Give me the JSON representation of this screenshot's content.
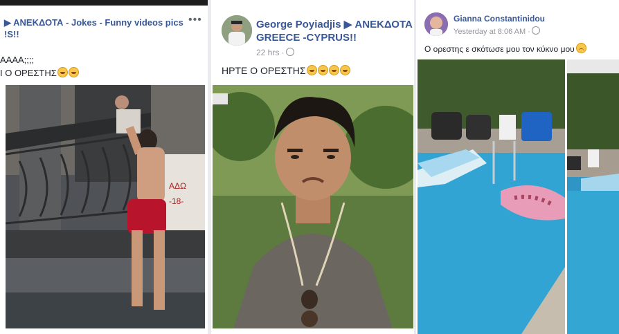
{
  "panel1": {
    "group_title_line1": "▶ ΑΝΕΚΔΟΤΑ - Jokes - Funny videos pics",
    "group_title_line2": "!S!!",
    "more_label": "•••",
    "text_line1": "AAAA;;;;",
    "text_line2": "Ι Ο ΟΡΕΣΤΗΣ",
    "photo_icon": "man-climbing-balcony-photo"
  },
  "panel2": {
    "author_line1": "George Poyiadjis ▶ ΑΝΕΚΔΟΤΑ",
    "author_line2": "GREECE -CYPRUS!!",
    "time": "22 hrs ·",
    "post_text": "ΗΡΤΕ Ο ΟΡΕΣΤΗΣ",
    "photo_icon": "man-frowning-photo"
  },
  "panel3": {
    "author": "Gianna Constantinidou",
    "time": "Yesterday at 8:06 AM ·",
    "post_text": "Ο ορεστης ε σκότωσε μου τον κύκνο μου",
    "photo_icon": "pool-with-swan-float-photo"
  }
}
